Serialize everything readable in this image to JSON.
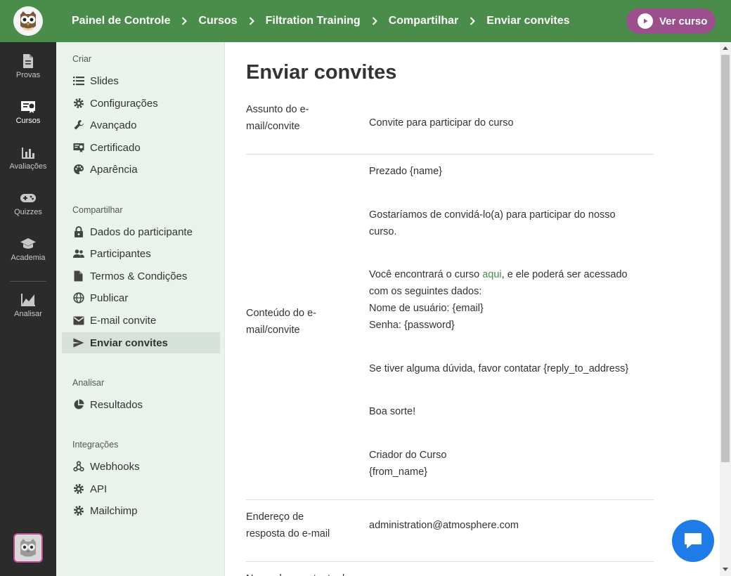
{
  "breadcrumbs": [
    "Painel de Controle",
    "Cursos",
    "Filtration Training",
    "Compartilhar",
    "Enviar convites"
  ],
  "header": {
    "view_course_label": "Ver curso"
  },
  "rail": [
    {
      "label": "Provas",
      "icon": "document-icon"
    },
    {
      "label": "Cursos",
      "icon": "certificate-icon",
      "active": true
    },
    {
      "label": "Avaliações",
      "icon": "bar-chart-icon"
    },
    {
      "label": "Quizzes",
      "icon": "gamepad-icon"
    },
    {
      "label": "Academia",
      "icon": "graduation-cap-icon"
    },
    {
      "label": "Analisar",
      "icon": "area-chart-icon"
    }
  ],
  "sidebar": {
    "sections": [
      {
        "title": "Criar",
        "items": [
          "Slides",
          "Configurações",
          "Avançado",
          "Certificado",
          "Aparência"
        ]
      },
      {
        "title": "Compartilhar",
        "items": [
          "Dados do participante",
          "Participantes",
          "Termos & Condições",
          "Publicar",
          "E-mail convite",
          "Enviar convites"
        ]
      },
      {
        "title": "Analisar",
        "items": [
          "Resultados"
        ]
      },
      {
        "title": "Integrações",
        "items": [
          "Webhooks",
          "API",
          "Mailchimp"
        ]
      }
    ],
    "active_item": "Enviar convites"
  },
  "main": {
    "title": "Enviar convites",
    "subject_label": "Assunto do e-mail/convite",
    "subject_value": "Convite para participar do curso",
    "content_label": "Conteúdo do e-mail/convite",
    "content": {
      "greeting": "Prezado {name}",
      "invite": "Gostaríamos de convidá-lo(a) para participar do nosso curso.",
      "find_prefix": "Você encontrará o curso ",
      "find_link": "aqui",
      "find_suffix": ", e ele poderá ser acessado com os seguintes dados:",
      "username": "Nome de usuário: {email}",
      "password": "Senha: {password}",
      "questions": "Se tiver alguma dúvida, favor contatar {reply_to_address}",
      "luck": "Boa sorte!",
      "signoff": "Criador do Curso",
      "from": "{from_name}"
    },
    "reply_label": "Endereço de resposta do e-mail",
    "reply_value": "administration@atmosphere.com",
    "next_label_partial": "Nome do remetente do"
  },
  "colors": {
    "header_green": "#4a8c4a",
    "ver_curso_purple": "#9b4f8c",
    "chat_blue": "#1e7be8",
    "rail_dark": "#2b2b2b",
    "sidebar_bg": "#eaf2ec"
  }
}
